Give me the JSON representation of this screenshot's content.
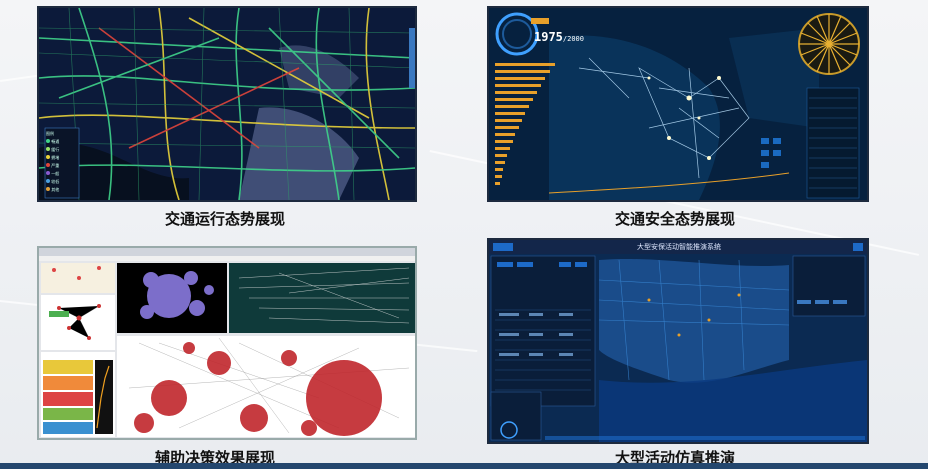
{
  "panels": {
    "traffic_operation": {
      "caption": "交通运行态势展现",
      "legend_title": "图例",
      "legend_items": [
        "畅通",
        "缓行",
        "拥堵",
        "严重",
        "一般",
        "较低",
        "其他"
      ]
    },
    "traffic_safety": {
      "caption": "交通安全态势展现",
      "counter": "1975",
      "counter_total": "/2000"
    },
    "decision_support": {
      "caption": "辅助决策效果展现"
    },
    "large_event": {
      "caption": "大型活动仿真推演",
      "title": "大型安保活动智能推演系统"
    }
  },
  "colors": {
    "accent": "#24476e",
    "map_dark": "#0c1a3a",
    "road_green": "#3fd38a",
    "road_yellow": "#e8d23a",
    "road_red": "#e0453a"
  }
}
